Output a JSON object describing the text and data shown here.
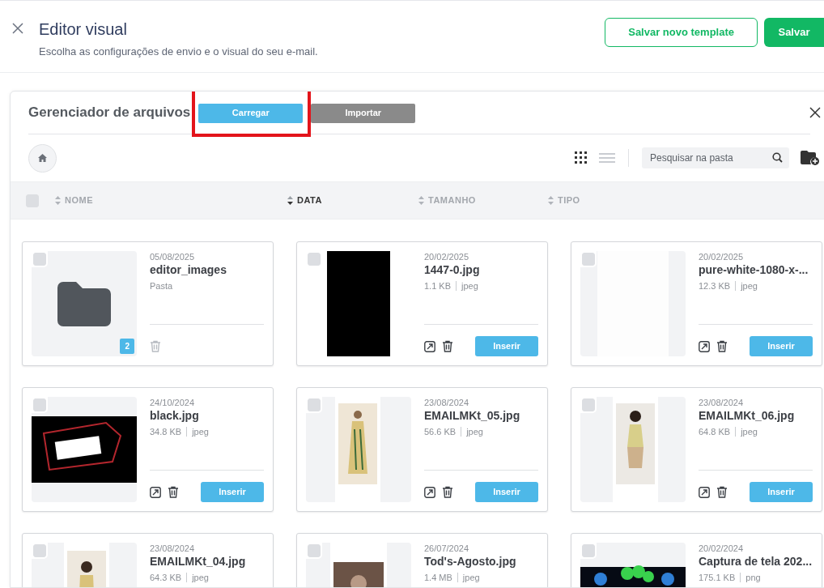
{
  "header": {
    "title": "Editor visual",
    "subtitle": "Escolha as configurações de envio e o visual do seu e-mail.",
    "buttons": [
      {
        "label": "Salvar novo template",
        "kind": "outline"
      },
      {
        "label": "Salvar",
        "kind": "primary"
      }
    ]
  },
  "file_manager": {
    "title": "Gerenciador de arquivos",
    "actions": [
      {
        "label": "Carregar",
        "kind": "primary",
        "highlighted": true
      },
      {
        "label": "Importar",
        "kind": "secondary",
        "highlighted": false
      }
    ],
    "views": [
      {
        "kind": "grid",
        "selected": true
      },
      {
        "kind": "list",
        "selected": false
      }
    ],
    "search": {
      "placeholder": "Pesquisar na pasta"
    },
    "columns": [
      {
        "label": "NOME",
        "sorted": false
      },
      {
        "label": "DATA",
        "sorted": true
      },
      {
        "label": "TAMANHO",
        "sorted": false
      },
      {
        "label": "TIPO",
        "sorted": false
      }
    ],
    "select_all": {
      "checked": false
    },
    "items": [
      {
        "kind": "folder",
        "checked": false,
        "date": "05/08/2025",
        "name": "editor_images",
        "subtitle": "Pasta",
        "count": "2"
      },
      {
        "kind": "picture",
        "checked": false,
        "date": "20/02/2025",
        "name": "1447-0.jpg",
        "size": "1.1 KB",
        "type": "jpeg",
        "insert": "Inserir"
      },
      {
        "kind": "picture",
        "checked": false,
        "date": "20/02/2025",
        "name": "pure-white-1080-x-...",
        "size": "12.3 KB",
        "type": "jpeg",
        "insert": "Inserir"
      },
      {
        "kind": "picture",
        "checked": false,
        "date": "24/10/2024",
        "name": "black.jpg",
        "size": "34.8 KB",
        "type": "jpeg",
        "insert": "Inserir"
      },
      {
        "kind": "picture",
        "checked": false,
        "date": "23/08/2024",
        "name": "EMAILMKt_05.jpg",
        "size": "56.6 KB",
        "type": "jpeg",
        "insert": "Inserir"
      },
      {
        "kind": "picture",
        "checked": false,
        "date": "23/08/2024",
        "name": "EMAILMKt_06.jpg",
        "size": "64.8 KB",
        "type": "jpeg",
        "insert": "Inserir"
      },
      {
        "kind": "picture",
        "checked": false,
        "date": "23/08/2024",
        "name": "EMAILMKt_04.jpg",
        "size": "64.3 KB",
        "type": "jpeg"
      },
      {
        "kind": "picture",
        "checked": false,
        "date": "26/07/2024",
        "name": "Tod's-Agosto.jpg",
        "size": "1.4 MB",
        "type": "jpeg"
      },
      {
        "kind": "picture",
        "checked": false,
        "date": "20/02/2024",
        "name": "Captura de tela 202...",
        "size": "175.1 KB",
        "type": "png"
      }
    ]
  }
}
